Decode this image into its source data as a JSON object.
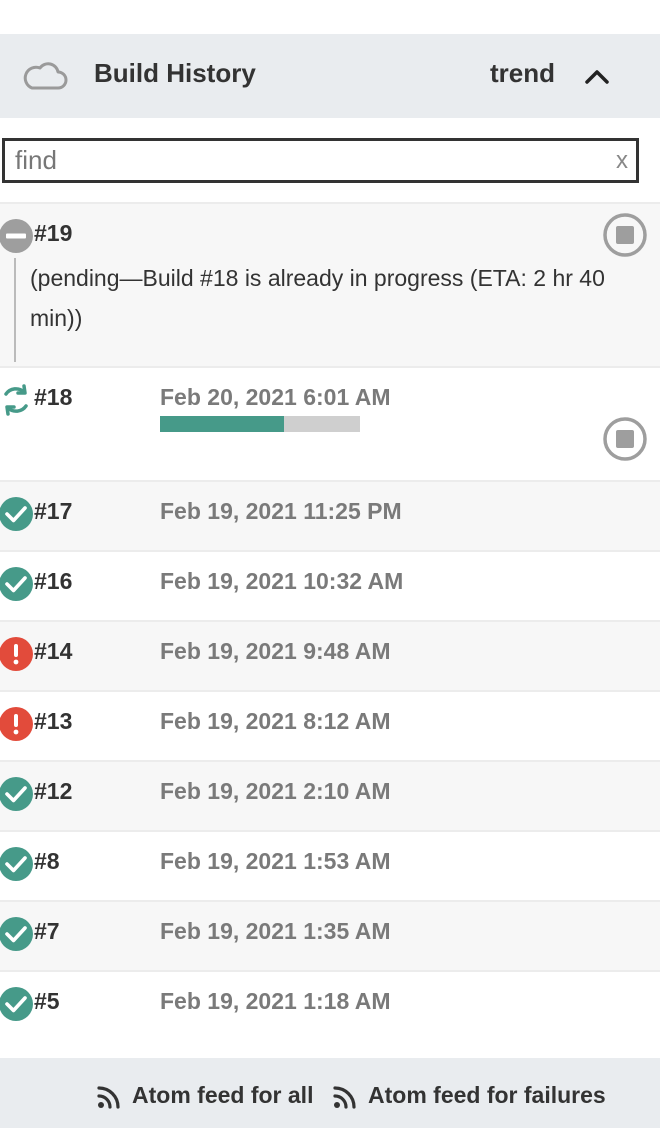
{
  "header": {
    "title": "Build History",
    "trend_label": "trend",
    "icon": "cloud-icon",
    "collapse_icon": "chevron-up-icon"
  },
  "search": {
    "placeholder": "find",
    "value": "",
    "clear_label": "x"
  },
  "builds": [
    {
      "number": "#19",
      "status": "aborted",
      "date": "",
      "note": "(pending—Build #18 is already in progress (ETA: 2 hr 40 min))"
    },
    {
      "number": "#18",
      "status": "running",
      "date": "Feb 20, 2021 6:01 AM",
      "progress": 0.62
    },
    {
      "number": "#17",
      "status": "success",
      "date": "Feb 19, 2021 11:25 PM"
    },
    {
      "number": "#16",
      "status": "success",
      "date": "Feb 19, 2021 10:32 AM"
    },
    {
      "number": "#14",
      "status": "failure",
      "date": "Feb 19, 2021 9:48 AM"
    },
    {
      "number": "#13",
      "status": "failure",
      "date": "Feb 19, 2021 8:12 AM"
    },
    {
      "number": "#12",
      "status": "success",
      "date": "Feb 19, 2021 2:10 AM"
    },
    {
      "number": "#8",
      "status": "success",
      "date": "Feb 19, 2021 1:53 AM"
    },
    {
      "number": "#7",
      "status": "success",
      "date": "Feb 19, 2021 1:35 AM"
    },
    {
      "number": "#5",
      "status": "success",
      "date": "Feb 19, 2021 1:18 AM"
    }
  ],
  "footer": {
    "feed_all": "Atom feed for all",
    "feed_failures": "Atom feed for failures",
    "icon": "rss-icon"
  },
  "colors": {
    "success": "#469a89",
    "failure": "#e24b3b",
    "aborted": "#9e9e9e",
    "progress_fill": "#469a89",
    "progress_track": "#cfcfcf"
  }
}
